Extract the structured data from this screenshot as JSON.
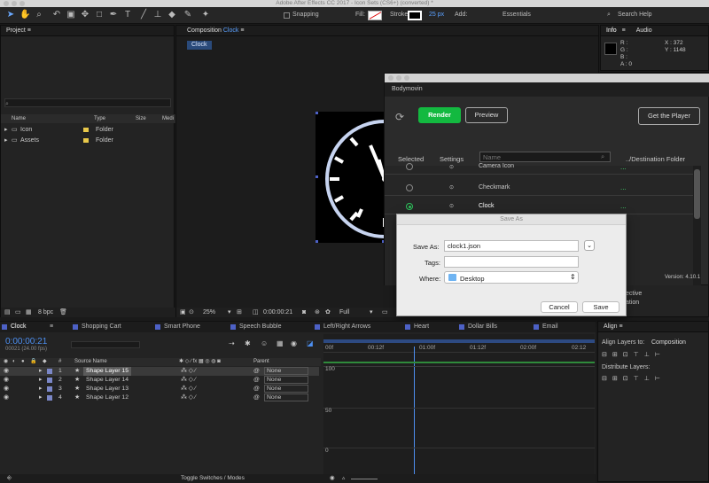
{
  "window_title": "Adobe After Effects CC 2017 - Icon Sets (CS6+) (converted) *",
  "toolbar": {
    "snapping": "Snapping",
    "fill": "Fill:",
    "stroke": "Stroke:",
    "stroke_px": "25 px",
    "add": "Add:",
    "workspace": "Essentials",
    "search": "Search Help"
  },
  "project": {
    "title": "Project",
    "columns": [
      "Name",
      "Type",
      "Size",
      "Medi"
    ],
    "items": [
      {
        "name": "Icon",
        "type": "Folder"
      },
      {
        "name": "Assets",
        "type": "Folder"
      }
    ],
    "bpc": "8 bpc"
  },
  "composition": {
    "tab": "Composition",
    "name": "Clock",
    "sub_tab": "Clock",
    "zoom": "25%",
    "timecode": "0:00:00:21",
    "resolution": "Full"
  },
  "info": {
    "tab_info": "Info",
    "tab_audio": "Audio",
    "r": "R :",
    "g": "G :",
    "b": "B :",
    "a": "A : 0",
    "x": "X : 372",
    "y": "Y : 1148"
  },
  "bodymovin": {
    "title": "Bodymovin",
    "render": "Render",
    "preview": "Preview",
    "get_player": "Get the Player",
    "col_selected": "Selected",
    "col_settings": "Settings",
    "search_placeholder": "Name",
    "col_dest": "../Destination Folder",
    "rows": [
      {
        "name": "Camera Icon",
        "dest": "..."
      },
      {
        "name": "Checkmark",
        "dest": "..."
      },
      {
        "name": "Clock",
        "dest": "..."
      }
    ],
    "version": "Version: 4.10.1",
    "behind1": "ective",
    "behind2": "ation"
  },
  "save_dialog": {
    "title": "Save As",
    "save_as_label": "Save As:",
    "filename": "clock1.json",
    "tags_label": "Tags:",
    "where_label": "Where:",
    "where": "Desktop",
    "cancel": "Cancel",
    "save": "Save"
  },
  "timeline": {
    "tabs": [
      "Clock",
      "Shopping Cart",
      "Smart Phone",
      "Speech Bubble",
      "Left/Right Arrows",
      "Heart",
      "Dollar Bills",
      "Email"
    ],
    "timecode": "0:00:00:21",
    "frames": "00021 (24.00 fps)",
    "col_hash": "#",
    "col_source": "Source Name",
    "col_parent": "Parent",
    "ruler": [
      "00f",
      "00:12f",
      "01:00f",
      "01:12f",
      "02:00f",
      "02:12"
    ],
    "graph_values": [
      "100",
      "50",
      "0"
    ],
    "layers": [
      {
        "num": "1",
        "name": "Shape Layer 15",
        "parent": "None"
      },
      {
        "num": "2",
        "name": "Shape Layer 14",
        "parent": "None"
      },
      {
        "num": "3",
        "name": "Shape Layer 13",
        "parent": "None"
      },
      {
        "num": "4",
        "name": "Shape Layer 12",
        "parent": "None"
      }
    ],
    "toggle": "Toggle Switches / Modes"
  },
  "align": {
    "title": "Align",
    "align_to_label": "Align Layers to:",
    "align_to": "Composition",
    "distribute": "Distribute Layers:"
  }
}
